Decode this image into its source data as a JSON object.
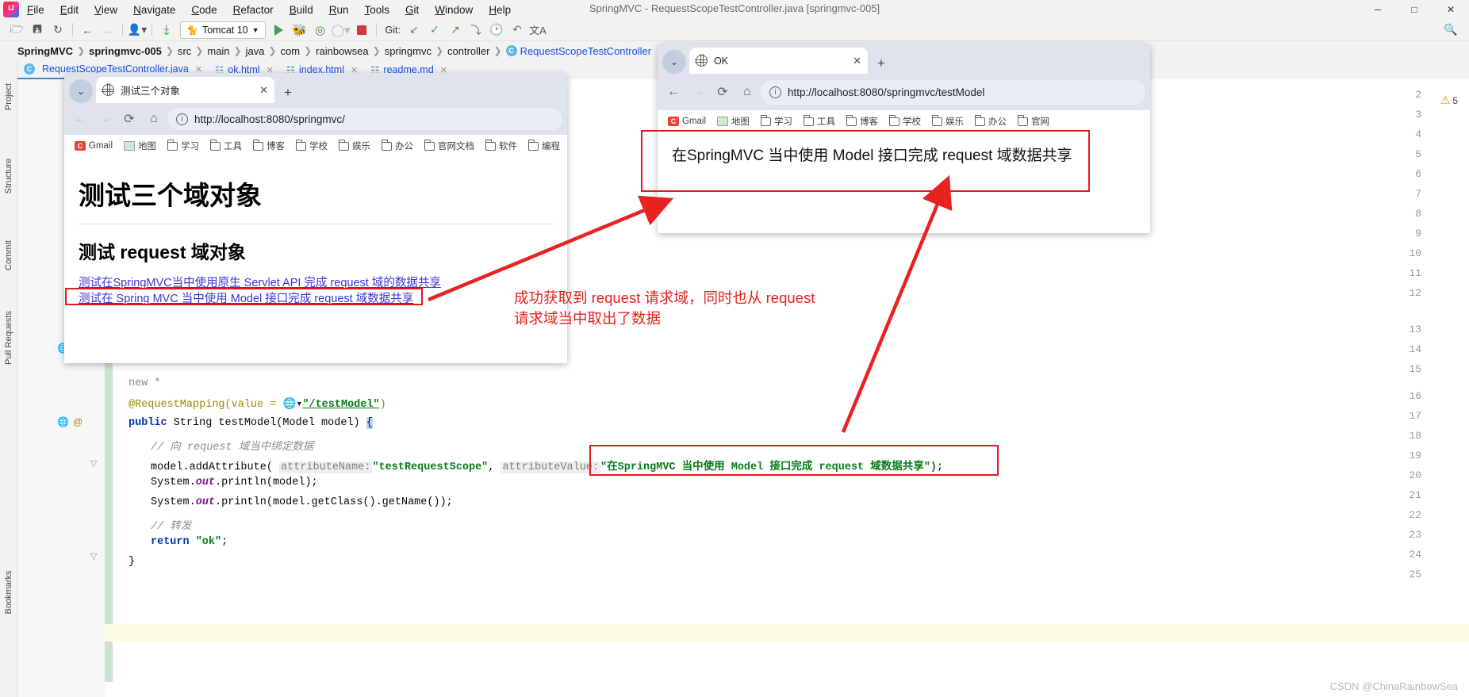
{
  "ide": {
    "window_title": "SpringMVC - RequestScopeTestController.java [springmvc-005]",
    "menu": [
      "File",
      "Edit",
      "View",
      "Navigate",
      "Code",
      "Refactor",
      "Build",
      "Run",
      "Tools",
      "Git",
      "Window",
      "Help"
    ],
    "window_controls": {
      "minimize": "─",
      "maximize": "□",
      "close": "✕"
    },
    "toolbar": {
      "open_icon": "folder-open-icon",
      "save_icon": "save-icon",
      "sync_icon": "sync-icon",
      "back_icon": "←",
      "forward_icon": "→",
      "profile_icon": "user-icon",
      "build_icon": "hammer-icon",
      "run_config": "Tomcat 10",
      "run_icon": "run-icon",
      "debug_icon": "debug-icon",
      "coverage_icon": "coverage-icon",
      "profiler_icon": "profiler-icon",
      "stop_icon": "stop-icon",
      "git_label": "Git:",
      "git_update": "↙",
      "git_commit": "✓",
      "git_push": "↗",
      "git_history": "↺",
      "clock_icon": "history-icon",
      "undo_icon": "↶",
      "translate_icon": "文A",
      "search_icon": "search-icon"
    },
    "breadcrumbs": [
      "SpringMVC",
      "springmvc-005",
      "src",
      "main",
      "java",
      "com",
      "rainbowsea",
      "springmvc",
      "controller",
      "RequestScopeTestController"
    ],
    "editor_tabs": [
      {
        "label": "RequestScopeTestController.java",
        "icon": "java-class-icon",
        "active": true
      },
      {
        "label": "ok.html",
        "icon": "html-file-icon",
        "active": false
      },
      {
        "label": "index.html",
        "icon": "html-file-icon",
        "active": false
      },
      {
        "label": "readme.md",
        "icon": "markdown-file-icon",
        "active": false
      }
    ],
    "rail_labels": [
      "Project",
      "Structure",
      "Commit",
      "Pull Requests",
      "Bookmarks"
    ],
    "warning_count": "5",
    "line_numbers": [
      "2",
      "3",
      "4",
      "5",
      "6",
      "7",
      "8",
      "9",
      "10",
      "11",
      "12",
      "13",
      "14",
      "15",
      "16",
      "17",
      "18",
      "19",
      "20",
      "21",
      "22",
      "23",
      "24",
      "25"
    ],
    "code_lines": [
      {
        "n": "",
        "indent": 0,
        "text": "new *"
      },
      {
        "n": "16",
        "indent": 0,
        "text": "@RequestMapping(value = \"/testModel\")"
      },
      {
        "n": "17",
        "indent": 0,
        "text": "public String testModel(Model model) {"
      },
      {
        "n": "18",
        "indent": 1,
        "text": "// 向 request 域当中绑定数据"
      },
      {
        "n": "19",
        "indent": 1,
        "text": "model.addAttribute( attributeName: \"testRequestScope\",  attributeValue: \"在SpringMVC 当中使用 Model 接口完成 request 域数据共享\");"
      },
      {
        "n": "20",
        "indent": 1,
        "text": "System.out.println(model);"
      },
      {
        "n": "21",
        "indent": 1,
        "text": "System.out.println(model.getClass().getName());"
      },
      {
        "n": "22",
        "indent": 1,
        "text": "// 转发"
      },
      {
        "n": "23",
        "indent": 1,
        "text": "return \"ok\";"
      },
      {
        "n": "24",
        "indent": 0,
        "text": "}"
      }
    ],
    "code_tokens": {
      "new_star": "new *",
      "annotation": "@RequestMapping(value = ",
      "mapping_path": "\"/testModel\"",
      "annotation_close": ")",
      "kw_public": "public",
      "sig": " String testModel(Model model) ",
      "brace_open": "{",
      "comment18": "// 向 request 域当中绑定数据",
      "add_attr": "model.addAttribute( ",
      "hint_name": "attributeName:",
      "str_name": "\"testRequestScope\"",
      "comma": ", ",
      "hint_value": "attributeValue:",
      "str_value": "\"在SpringMVC 当中使用 Model 接口完成 request 域数据共享\")",
      "semicolon": ";",
      "sout1": "System.",
      "out": "out",
      "sout1b": ".println(model);",
      "sout2b": ".println(model.getClass().getName());",
      "comment22": "// 转发",
      "kw_return": "return",
      "str_ok": " \"ok\"",
      "brace_close": "}"
    }
  },
  "browser1": {
    "tab_title": "测试三个对象",
    "tab_close": "✕",
    "new_tab": "+",
    "chevron": "⌄",
    "nav": {
      "back": "←",
      "forward": "→",
      "reload": "⟳",
      "home": "⌂",
      "info": "i"
    },
    "url": "http://localhost:8080/springmvc/",
    "bookmarks": [
      "Gmail",
      "地图",
      "学习",
      "工具",
      "博客",
      "学校",
      "娱乐",
      "办公",
      "官网文档",
      "软件",
      "编程"
    ],
    "page": {
      "h1": "测试三个域对象",
      "h2": "测试 request 域对象",
      "link1": "测试在SpringMVC当中使用原生 Servlet API 完成 request 域的数据共享",
      "link2": "测试在 Spring MVC 当中使用 Model 接口完成 request 域数据共享"
    }
  },
  "browser2": {
    "tab_title": "OK",
    "tab_close": "✕",
    "new_tab": "+",
    "chevron": "⌄",
    "nav": {
      "back": "←",
      "forward": "→",
      "reload": "⟳",
      "home": "⌂",
      "info": "i"
    },
    "url": "http://localhost:8080/springmvc/testModel",
    "bookmarks": [
      "Gmail",
      "地图",
      "学习",
      "工具",
      "博客",
      "学校",
      "娱乐",
      "办公",
      "官网"
    ],
    "page": {
      "body_text": "在SpringMVC 当中使用 Model 接口完成 request 域数据共享"
    }
  },
  "annotations": {
    "note_line1": "成功获取到 request 请求域，同时也从 request",
    "note_line2": "请求域当中取出了数据",
    "accent_color": "#e8221f"
  },
  "watermark": "CSDN @ChinaRainbowSea"
}
